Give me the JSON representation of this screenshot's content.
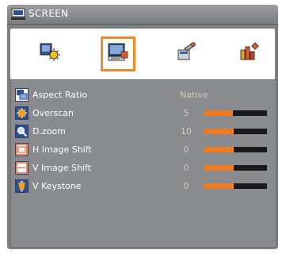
{
  "window": {
    "title": "SCREEN",
    "title_icon": "screen-icon"
  },
  "tabs": [
    {
      "name": "image",
      "icon": "image-settings-icon",
      "active": false
    },
    {
      "name": "screen",
      "icon": "screen-settings-icon",
      "active": true
    },
    {
      "name": "setting",
      "icon": "setting-icon",
      "active": false
    },
    {
      "name": "options",
      "icon": "options-icon",
      "active": false
    }
  ],
  "menu": [
    {
      "label": "Aspect Ratio",
      "value": "Native",
      "icon": "aspect-ratio-icon"
    },
    {
      "label": "Overscan",
      "value": "5",
      "level": 0.45,
      "icon": "overscan-icon"
    },
    {
      "label": "D.zoom",
      "value": "10",
      "level": 0.47,
      "icon": "dzoom-icon"
    },
    {
      "label": "H Image Shift",
      "value": "0",
      "level": 0.47,
      "icon": "h-image-shift-icon"
    },
    {
      "label": "V Image Shift",
      "value": "0",
      "level": 0.47,
      "icon": "v-image-shift-icon"
    },
    {
      "label": "V Keystone",
      "value": "0",
      "level": 0.47,
      "icon": "v-keystone-icon"
    }
  ],
  "colors": {
    "accent": "#f08a2c",
    "bar_fill": "#ee7a22",
    "panel": "#898b8f"
  }
}
